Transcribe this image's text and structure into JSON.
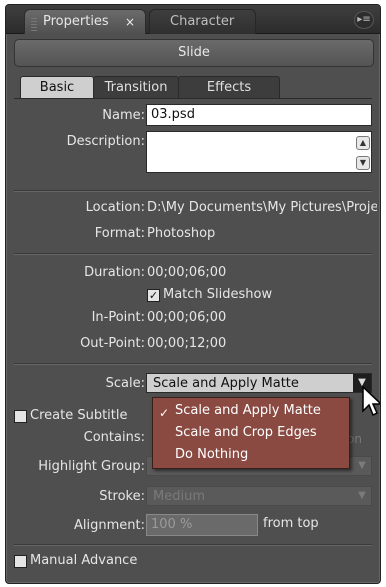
{
  "panel": {
    "tabs": [
      {
        "label": "Properties",
        "close": "×"
      },
      {
        "label": "Character"
      }
    ],
    "menu_icon": "panel-menu-icon"
  },
  "slide": {
    "title": "Slide"
  },
  "subtabs": [
    "Basic",
    "Transition",
    "Effects"
  ],
  "fields": {
    "name_label": "Name:",
    "name_value": "03.psd",
    "description_label": "Description:",
    "description_value": "",
    "location_label": "Location:",
    "location_value": "D:\\My Documents\\My Pictures\\Proje",
    "format_label": "Format:",
    "format_value": "Photoshop",
    "duration_label": "Duration:",
    "duration_value": "00;00;06;00",
    "match_slideshow_label": "Match Slideshow",
    "in_point_label": "In-Point:",
    "in_point_value": "00;00;06;00",
    "out_point_label": "Out-Point:",
    "out_point_value": "00;00;12;00",
    "scale_label": "Scale:",
    "scale_value": "Scale and Apply Matte",
    "create_subtitle_label": "Create Subtitle",
    "contains_label": "Contains:",
    "highlight_group_label": "Highlight Group:",
    "stroke_label": "Stroke:",
    "stroke_value": "Medium",
    "alignment_label": "Alignment:",
    "alignment_value": "100 %",
    "from_top_label": "from top",
    "manual_advance_label": "Manual Advance",
    "partial_on": "on"
  },
  "scale_menu": {
    "items": [
      "Scale and Apply Matte",
      "Scale and Crop Edges",
      "Do Nothing"
    ],
    "selected": "Scale and Apply Matte"
  },
  "colors": {
    "panel_bg": "#4f4f4f",
    "menu_bg": "#8a4a42"
  }
}
